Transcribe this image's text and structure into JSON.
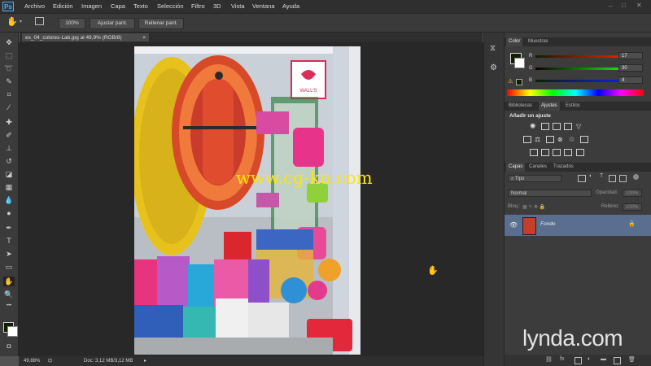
{
  "app": {
    "logo": "Ps"
  },
  "menu": [
    "Archivo",
    "Edición",
    "Imagen",
    "Capa",
    "Texto",
    "Selección",
    "Filtro",
    "3D",
    "Vista",
    "Ventana",
    "Ayuda"
  ],
  "options_bar": {
    "zoom_label": "100%",
    "fit_label": "Ajustar pant.",
    "fill_label": "Rellenar pant."
  },
  "document": {
    "tab_title": "es_04_colores-Lab.jpg al 49,9% (RGB/8)",
    "close": "×"
  },
  "canvas": {
    "watermark": "www.cg-ku.com",
    "sign_text": "WALL'S"
  },
  "status": {
    "zoom": "49,88%",
    "doc_info": "Doc: 3,12 MB/3,12 MB"
  },
  "color_panel": {
    "tabs": [
      "Color",
      "Muestras"
    ],
    "channels": [
      {
        "label": "R",
        "value": "17"
      },
      {
        "label": "G",
        "value": "30"
      },
      {
        "label": "B",
        "value": "4"
      }
    ],
    "foreground": "#111e04"
  },
  "adjust_panel": {
    "tabs": [
      "Bibliotecas",
      "Ajustes",
      "Estilos"
    ],
    "heading": "Añadir un ajuste"
  },
  "layers_panel": {
    "tabs": [
      "Capas",
      "Canales",
      "Trazados"
    ],
    "filter_label": "Tipo",
    "blend_mode": "Normal",
    "opacity_label": "Opacidad:",
    "opacity_value": "100%",
    "lock_label": "Bloq.:",
    "fill_label": "Relleno:",
    "fill_value": "100%",
    "layers": [
      {
        "name": "Fondo"
      }
    ]
  },
  "branding": {
    "text": "lynda.com"
  }
}
